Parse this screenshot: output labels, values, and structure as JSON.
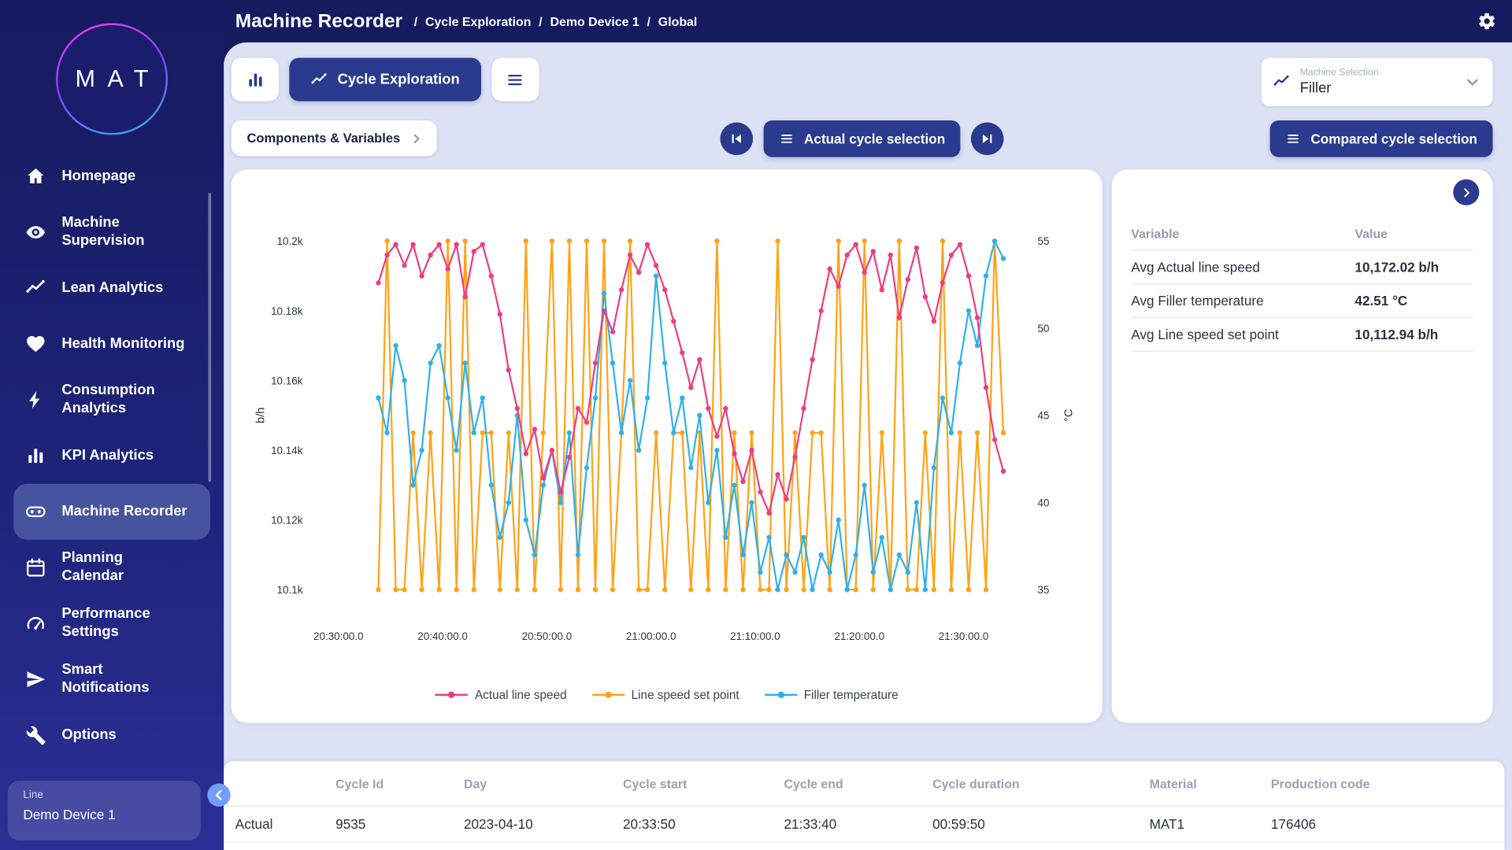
{
  "header": {
    "title": "Machine Recorder",
    "breadcrumbs": [
      "Cycle Exploration",
      "Demo Device 1",
      "Global"
    ]
  },
  "sidebar": {
    "logo": "MAT",
    "active_index": 6,
    "items": [
      {
        "label": "Homepage",
        "icon": "home"
      },
      {
        "label": "Machine\nSupervision",
        "icon": "eye"
      },
      {
        "label": "Lean Analytics",
        "icon": "trend"
      },
      {
        "label": "Health Monitoring",
        "icon": "heart"
      },
      {
        "label": "Consumption\nAnalytics",
        "icon": "bolt"
      },
      {
        "label": "KPI Analytics",
        "icon": "bars"
      },
      {
        "label": "Machine Recorder",
        "icon": "recorder"
      },
      {
        "label": "Planning\nCalendar",
        "icon": "calendar"
      },
      {
        "label": "Performance\nSettings",
        "icon": "gauge"
      },
      {
        "label": "Smart\nNotifications",
        "icon": "send"
      },
      {
        "label": "Options",
        "icon": "wrench"
      }
    ],
    "device_panel": {
      "label": "Line",
      "name": "Demo Device 1"
    }
  },
  "toolbar": {
    "cycle_exploration_label": "Cycle Exploration",
    "machine_selection": {
      "label": "Machine Selection",
      "value": "Filler"
    },
    "components_button": "Components & Variables",
    "actual_cycle_button": "Actual cycle selection",
    "compared_cycle_button": "Compared cycle selection"
  },
  "stats_panel": {
    "columns": [
      "Variable",
      "Value"
    ],
    "rows": [
      {
        "variable": "Avg Actual line speed",
        "value": "10,172.02 b/h"
      },
      {
        "variable": "Avg Filler temperature",
        "value": "42.51 °C"
      },
      {
        "variable": "Avg Line speed set point",
        "value": "10,112.94 b/h"
      }
    ]
  },
  "cycle_table": {
    "columns": [
      "",
      "Cycle Id",
      "Day",
      "Cycle start",
      "Cycle end",
      "Cycle duration",
      "Material",
      "Production code"
    ],
    "rows": [
      [
        "Actual",
        "9535",
        "2023-04-10",
        "20:33:50",
        "21:33:40",
        "00:59:50",
        "MAT1",
        "176406"
      ]
    ]
  },
  "theme": {
    "accent": "#2a3a8e",
    "content_background": "#dde1f4"
  },
  "chart_data": {
    "type": "line",
    "grid": false,
    "legend_position": "bottom",
    "x_axis": {
      "domain": [
        27.5,
        96
      ],
      "start_min": 33.83,
      "step_min": 0.8333,
      "tick_values": [
        30,
        40,
        50,
        60,
        70,
        80,
        90
      ],
      "tick_labels": [
        "20:30:00.0",
        "20:40:00.0",
        "20:50:00.0",
        "21:00:00.0",
        "21:10:00.0",
        "21:20:00.0",
        "21:30:00.0"
      ]
    },
    "left_axis": {
      "label": "b/h",
      "domain": [
        10095,
        10205
      ],
      "tick_values": [
        10100,
        10120,
        10140,
        10160,
        10180,
        10200
      ],
      "tick_labels": [
        "10.1k",
        "10.12k",
        "10.14k",
        "10.16k",
        "10.18k",
        "10.2k"
      ]
    },
    "right_axis": {
      "label": "°C",
      "domain": [
        34,
        56
      ],
      "tick_values": [
        35,
        40,
        45,
        50,
        55
      ],
      "tick_labels": [
        "35",
        "40",
        "45",
        "50",
        "55"
      ]
    },
    "series": [
      {
        "name": "Actual line speed",
        "color": "#ee3d7f",
        "axis": "left",
        "values": [
          10188,
          10196,
          10199,
          10193,
          10199,
          10190,
          10196,
          10199,
          10192,
          10199,
          10184,
          10197,
          10199,
          10190,
          10179,
          10163,
          10152,
          10139,
          10146,
          10132,
          10140,
          10128,
          10138,
          10152,
          10148,
          10165,
          10180,
          10174,
          10186,
          10196,
          10191,
          10199,
          10193,
          10186,
          10177,
          10168,
          10158,
          10166,
          10152,
          10144,
          10152,
          10139,
          10131,
          10140,
          10128,
          10122,
          10133,
          10126,
          10138,
          10152,
          10166,
          10180,
          10192,
          10187,
          10196,
          10199,
          10191,
          10197,
          10186,
          10196,
          10178,
          10189,
          10198,
          10184,
          10177,
          10188,
          10196,
          10199,
          10190,
          10178,
          10158,
          10143,
          10134
        ]
      },
      {
        "name": "Line speed set point",
        "color": "#ffa216",
        "axis": "left",
        "values": [
          10100,
          10200,
          10100,
          10100,
          10145,
          10100,
          10145,
          10100,
          10200,
          10100,
          10200,
          10100,
          10145,
          10145,
          10100,
          10145,
          10100,
          10200,
          10100,
          10145,
          10200,
          10100,
          10200,
          10100,
          10200,
          10100,
          10200,
          10100,
          10145,
          10200,
          10100,
          10100,
          10145,
          10100,
          10145,
          10145,
          10100,
          10145,
          10100,
          10200,
          10100,
          10145,
          10100,
          10145,
          10100,
          10100,
          10200,
          10100,
          10145,
          10100,
          10145,
          10145,
          10100,
          10200,
          10100,
          10100,
          10200,
          10100,
          10145,
          10100,
          10200,
          10100,
          10100,
          10145,
          10100,
          10200,
          10100,
          10145,
          10100,
          10145,
          10100,
          10200,
          10145
        ]
      },
      {
        "name": "Filler temperature",
        "color": "#2fb1ea",
        "axis": "right",
        "values": [
          46,
          44,
          49,
          47,
          41,
          43,
          48,
          49,
          46,
          43,
          48,
          44,
          46,
          41,
          38,
          40,
          45,
          39,
          37,
          41,
          43,
          40,
          44,
          37,
          42,
          46,
          52,
          48,
          44,
          47,
          43,
          46,
          53,
          48,
          44,
          46,
          42,
          45,
          40,
          43,
          38,
          41,
          37,
          40,
          36,
          38,
          35,
          37,
          36,
          38,
          35,
          37,
          36,
          39,
          35,
          37,
          41,
          36,
          38,
          35,
          37,
          36,
          40,
          35,
          42,
          46,
          44,
          48,
          51,
          49,
          53,
          55,
          54
        ]
      }
    ]
  }
}
